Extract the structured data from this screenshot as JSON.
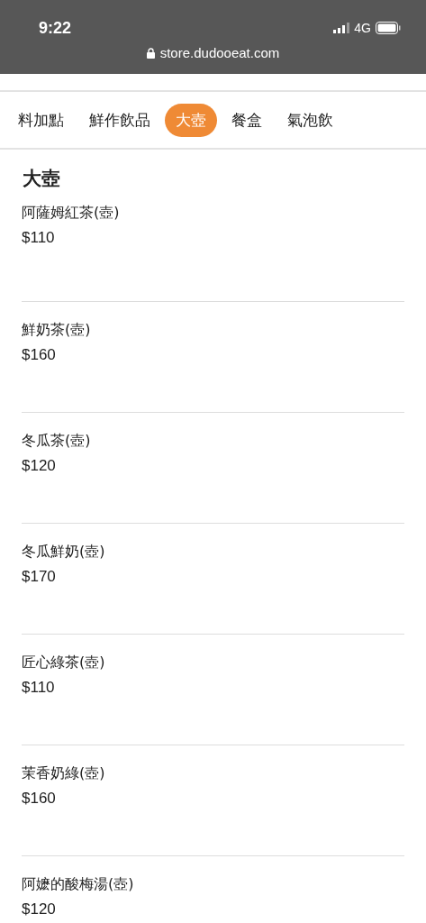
{
  "status_bar": {
    "time": "9:22",
    "network": "4G"
  },
  "address_bar": {
    "url": "store.dudooeat.com"
  },
  "tabs": [
    {
      "label": "料加點",
      "selected": false
    },
    {
      "label": "鮮作飲品",
      "selected": false
    },
    {
      "label": "大壺",
      "selected": true
    },
    {
      "label": "餐盒",
      "selected": false
    },
    {
      "label": "氣泡飲",
      "selected": false
    }
  ],
  "section": {
    "title": "大壺"
  },
  "items": [
    {
      "name": "阿薩姆紅茶(壺)",
      "price": "$110"
    },
    {
      "name": "鮮奶茶(壺)",
      "price": "$160"
    },
    {
      "name": "冬瓜茶(壺)",
      "price": "$120"
    },
    {
      "name": "冬瓜鮮奶(壺)",
      "price": "$170"
    },
    {
      "name": "匠心綠茶(壺)",
      "price": "$110"
    },
    {
      "name": "茉香奶綠(壺)",
      "price": "$160"
    },
    {
      "name": "阿嬷的酸梅湯(壺)",
      "price": "$120"
    }
  ]
}
